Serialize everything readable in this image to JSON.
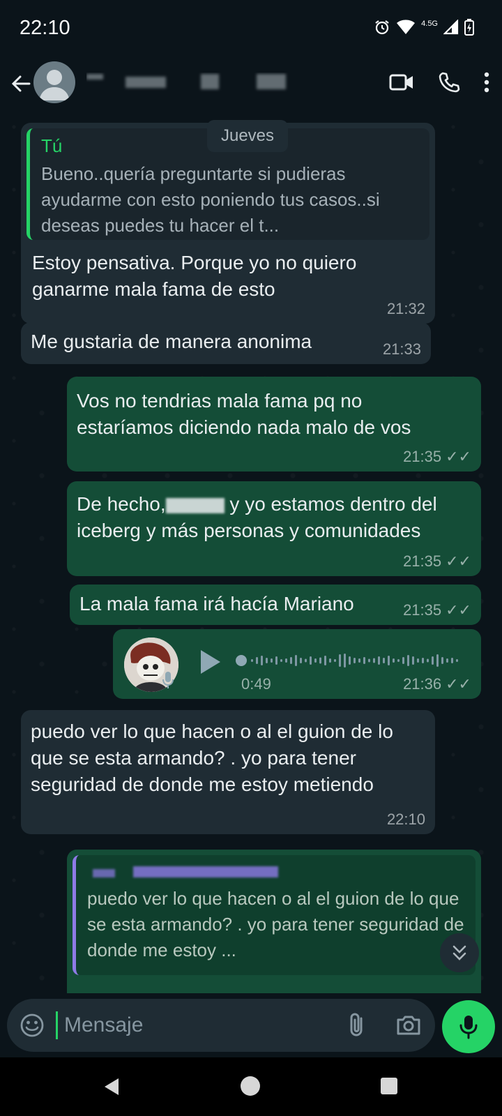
{
  "status_bar": {
    "time": "22:10",
    "network": "4.5G",
    "icons": [
      "alarm-icon",
      "wifi-icon",
      "signal-icon",
      "battery-icon"
    ]
  },
  "header": {
    "back_icon": "arrow-left-icon",
    "contact_name": "",
    "actions": [
      "video-call-icon",
      "voice-call-icon",
      "more-options-icon"
    ]
  },
  "date_chip": "Jueves",
  "messages": [
    {
      "direction": "incoming",
      "quote": {
        "author": "Tú",
        "text": "Bueno..quería preguntarte si pudieras ayudarme con esto poniendo tus casos..si deseas puedes tu hacer el t..."
      },
      "text": "Estoy pensativa. Porque yo no quiero ganarme mala fama de esto",
      "time": "21:32"
    },
    {
      "direction": "incoming",
      "text": "Me gustaria de manera anonima",
      "time": "21:33"
    },
    {
      "direction": "outgoing",
      "text": "Vos no tendrias mala fama pq no estaríamos diciendo nada malo de vos",
      "time": "21:35",
      "status": "read"
    },
    {
      "direction": "outgoing",
      "text_before": "De hecho,",
      "text_after": " y yo estamos dentro del iceberg y más personas y comunidades",
      "time": "21:35",
      "status": "read"
    },
    {
      "direction": "outgoing",
      "text": "La mala fama irá hacía Mariano",
      "time": "21:35",
      "status": "read"
    },
    {
      "direction": "outgoing",
      "type": "voice",
      "duration": "0:49",
      "time": "21:36",
      "status": "read",
      "progress": 0
    },
    {
      "direction": "incoming",
      "text": "puedo ver lo que hacen o al el guion de lo que se esta armando? . yo para tener seguridad de donde me estoy metiendo",
      "time": "22:10"
    },
    {
      "direction": "outgoing",
      "quote": {
        "author": "",
        "text": "puedo ver lo que hacen o al el guion de lo que se esta armando? . yo para tener seguridad de donde me estoy ..."
      }
    }
  ],
  "input": {
    "placeholder": "Mensaje",
    "value": ""
  },
  "colors": {
    "background": "#0b141a",
    "incoming_bubble": "#1f2c34",
    "outgoing_bubble": "#144d37",
    "accent": "#25d366",
    "quote_accent_outgoing": "#8e7ae6"
  }
}
